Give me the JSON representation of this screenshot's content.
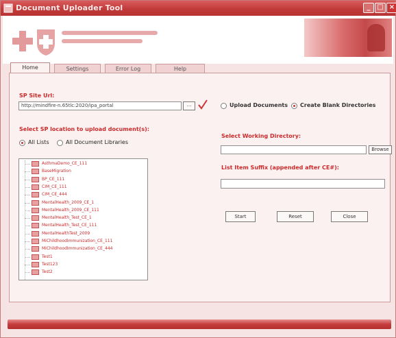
{
  "window": {
    "title": "Document Uploader Tool"
  },
  "colors": {
    "accent": "#cc3333",
    "background": "#f6e3e3",
    "label_red": "#cc2a2a"
  },
  "tabs": [
    {
      "label": "Home",
      "active": true
    },
    {
      "label": "Settings",
      "active": false
    },
    {
      "label": "Error Log",
      "active": false
    },
    {
      "label": "Help",
      "active": false
    }
  ],
  "home": {
    "sp_site_url": {
      "label": "SP Site Url:",
      "value": "http://mindfire-n.65tlc:2020/ipa_portal",
      "browse_label": "...",
      "status_icon": "checkmark-icon"
    },
    "mode": {
      "upload_label": "Upload Documents",
      "create_label": "Create Blank Directories",
      "selected": "create"
    },
    "location": {
      "label": "Select SP location to upload document(s):",
      "all_lists_label": "All Lists",
      "all_libraries_label": "All Document Libraries",
      "selected": "all_lists"
    },
    "tree_items": [
      "AsthmaDemo_CE_111",
      "BaseMigration",
      "BP_CE_111",
      "CIM_CE_111",
      "CIM_CE_444",
      "MentalHealth_2009_CE_1",
      "MentalHealth_2009_CE_111",
      "MentalHealth_Test_CE_1",
      "MentalHealth_Test_CE_111",
      "MentalHealthTest_2009",
      "MiChildhoodImmunization_CE_111",
      "MiChildhoodImmunization_CE_444",
      "Test1",
      "Test123",
      "Test2"
    ],
    "working_dir": {
      "label": "Select Working Directory:",
      "value": "",
      "browse_label": "Browse"
    },
    "suffix": {
      "label": "List Item Suffix (appended after CE#):",
      "value": ""
    },
    "buttons": {
      "start": "Start",
      "reset": "Reset",
      "close": "Close"
    }
  }
}
